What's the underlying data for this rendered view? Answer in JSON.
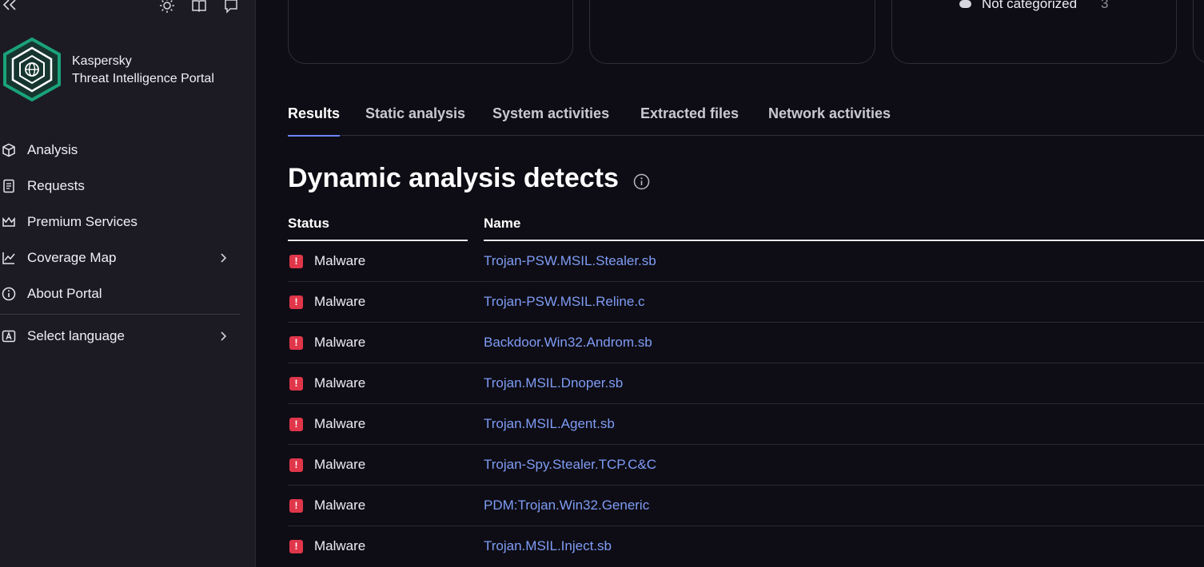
{
  "app": {
    "brand_line1": "Kaspersky",
    "brand_line2": "Threat Intelligence Portal"
  },
  "sidebar": {
    "items": [
      {
        "label": "Analysis",
        "icon": "cube-icon"
      },
      {
        "label": "Requests",
        "icon": "document-icon"
      },
      {
        "label": "Premium Services",
        "icon": "crown-icon"
      },
      {
        "label": "Coverage Map",
        "icon": "chart-line-icon",
        "has_submenu": true
      },
      {
        "label": "About Portal",
        "icon": "info-icon"
      }
    ],
    "language": {
      "label": "Select language",
      "icon": "language-icon"
    }
  },
  "summary_card": {
    "legend_label": "Not categorized",
    "legend_count": "3"
  },
  "tabs": [
    {
      "label": "Results",
      "active": true
    },
    {
      "label": "Static analysis"
    },
    {
      "label": "System activities"
    },
    {
      "label": "Extracted files"
    },
    {
      "label": "Network activities"
    }
  ],
  "section": {
    "title": "Dynamic analysis detects"
  },
  "table": {
    "columns": {
      "status": "Status",
      "name": "Name"
    },
    "rows": [
      {
        "status": "Malware",
        "name": "Trojan-PSW.MSIL.Stealer.sb"
      },
      {
        "status": "Malware",
        "name": "Trojan-PSW.MSIL.Reline.c"
      },
      {
        "status": "Malware",
        "name": "Backdoor.Win32.Androm.sb"
      },
      {
        "status": "Malware",
        "name": "Trojan.MSIL.Dnoper.sb"
      },
      {
        "status": "Malware",
        "name": "Trojan.MSIL.Agent.sb"
      },
      {
        "status": "Malware",
        "name": "Trojan-Spy.Stealer.TCP.C&C"
      },
      {
        "status": "Malware",
        "name": "PDM:Trojan.Win32.Generic"
      },
      {
        "status": "Malware",
        "name": "Trojan.MSIL.Inject.sb"
      }
    ]
  },
  "colors": {
    "accent": "#6c86ff",
    "link": "#7f9cf5",
    "malware": "#e0364a",
    "logo": "#1aa37a"
  }
}
